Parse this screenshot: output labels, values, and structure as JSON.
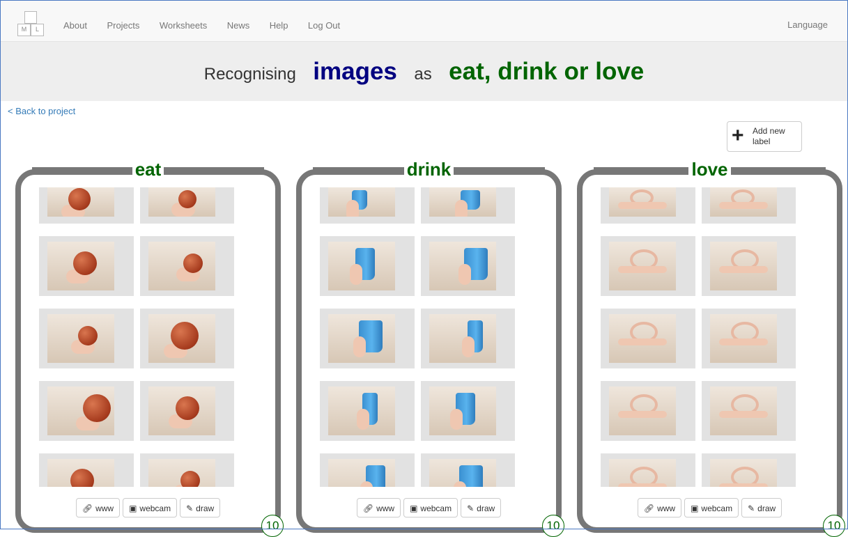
{
  "nav": {
    "logo_letters": [
      "M",
      "L"
    ],
    "links": [
      "About",
      "Projects",
      "Worksheets",
      "News",
      "Help",
      "Log Out"
    ],
    "language": "Language"
  },
  "header": {
    "prefix": "Recognising",
    "type": "images",
    "as_word": "as",
    "labels_text": "eat, drink or love"
  },
  "back_link": "< Back to project",
  "add_label": {
    "icon": "plus-icon",
    "text": "Add new label"
  },
  "buckets": [
    {
      "name": "eat",
      "count": "10",
      "object": "apple",
      "tools": [
        "www",
        "webcam",
        "draw"
      ]
    },
    {
      "name": "drink",
      "count": "10",
      "object": "cup",
      "tools": [
        "www",
        "webcam",
        "draw"
      ]
    },
    {
      "name": "love",
      "count": "10",
      "object": "heart-hands",
      "tools": [
        "www",
        "webcam",
        "draw"
      ]
    }
  ],
  "tool_icons": {
    "www": "link-icon",
    "webcam": "camera-icon",
    "draw": "pencil-icon"
  },
  "colors": {
    "label_green": "#006400",
    "type_navy": "#000080",
    "bucket_border": "#777777",
    "link_blue": "#337ab7"
  }
}
